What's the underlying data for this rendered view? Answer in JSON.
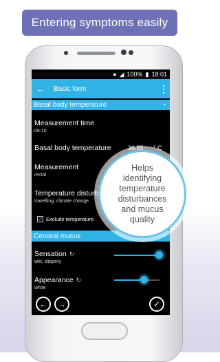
{
  "banner": {
    "text": "Entering symptoms easily"
  },
  "status": {
    "battery": "100%",
    "time": "18:01"
  },
  "appbar": {
    "back_icon": "arrow-left-icon",
    "title": "Basic form",
    "menu_icon": "overflow-menu-icon"
  },
  "sections": [
    {
      "title": "Basal body temperature",
      "icon": "chevron-down-icon"
    },
    {
      "title": "Cervical mucus",
      "icon": "chevron-down-icon"
    }
  ],
  "bbt": {
    "measurement_time": {
      "label": "Measurement time",
      "value": "08:10"
    },
    "temperature": {
      "label": "Basal body temperature",
      "value": "36.55",
      "unit": "° C"
    },
    "measurement": {
      "label": "Measurement",
      "value": "rectal"
    },
    "disturbances": {
      "label": "Temperature disturbances",
      "value": "travelling, climate change"
    },
    "exclude": {
      "label": "Exclude temperature",
      "checked": true
    }
  },
  "mucus": {
    "sensation": {
      "label": "Sensation",
      "value": "wet, slippery",
      "level": 1.0
    },
    "appearance": {
      "label": "Appearance",
      "value": "white",
      "level": 0.67
    }
  },
  "nav": {
    "prev_icon": "arrow-left-circle-icon",
    "next_icon": "arrow-right-circle-icon",
    "done_icon": "checkmark-circle-icon"
  },
  "bubble": {
    "text": "Helps\nidentifying\ntemperature\ndisturbances\nand mucus\nquality"
  }
}
